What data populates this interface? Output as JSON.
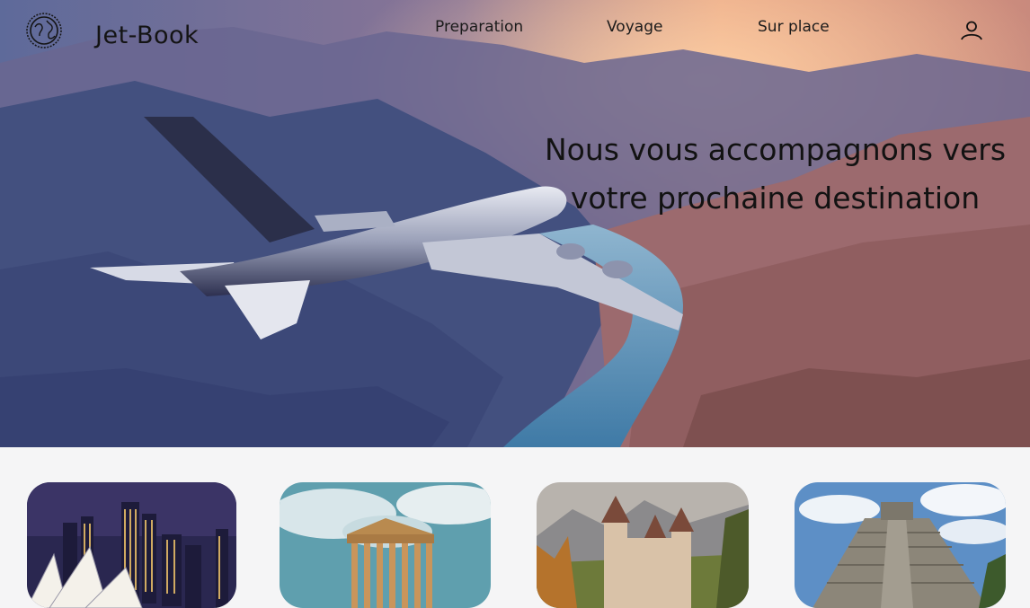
{
  "header": {
    "brand": "Jet-Book",
    "logo_icon": "globe-icon",
    "nav": [
      {
        "label": "Preparation"
      },
      {
        "label": "Voyage"
      },
      {
        "label": "Sur place"
      }
    ],
    "account_icon": "user-icon"
  },
  "hero": {
    "headline_line1": "Nous vous accompagnons vers",
    "headline_line2": "votre prochaine destination",
    "image": "airplane-over-canyon"
  },
  "destinations": [
    {
      "image": "sydney-opera-house"
    },
    {
      "image": "greek-temple"
    },
    {
      "image": "castle"
    },
    {
      "image": "mayan-pyramid"
    }
  ],
  "colors": {
    "text": "#141414",
    "page_background": "#f5f5f6",
    "sunset": "#e9a27a",
    "water": "#5a8fb7"
  }
}
